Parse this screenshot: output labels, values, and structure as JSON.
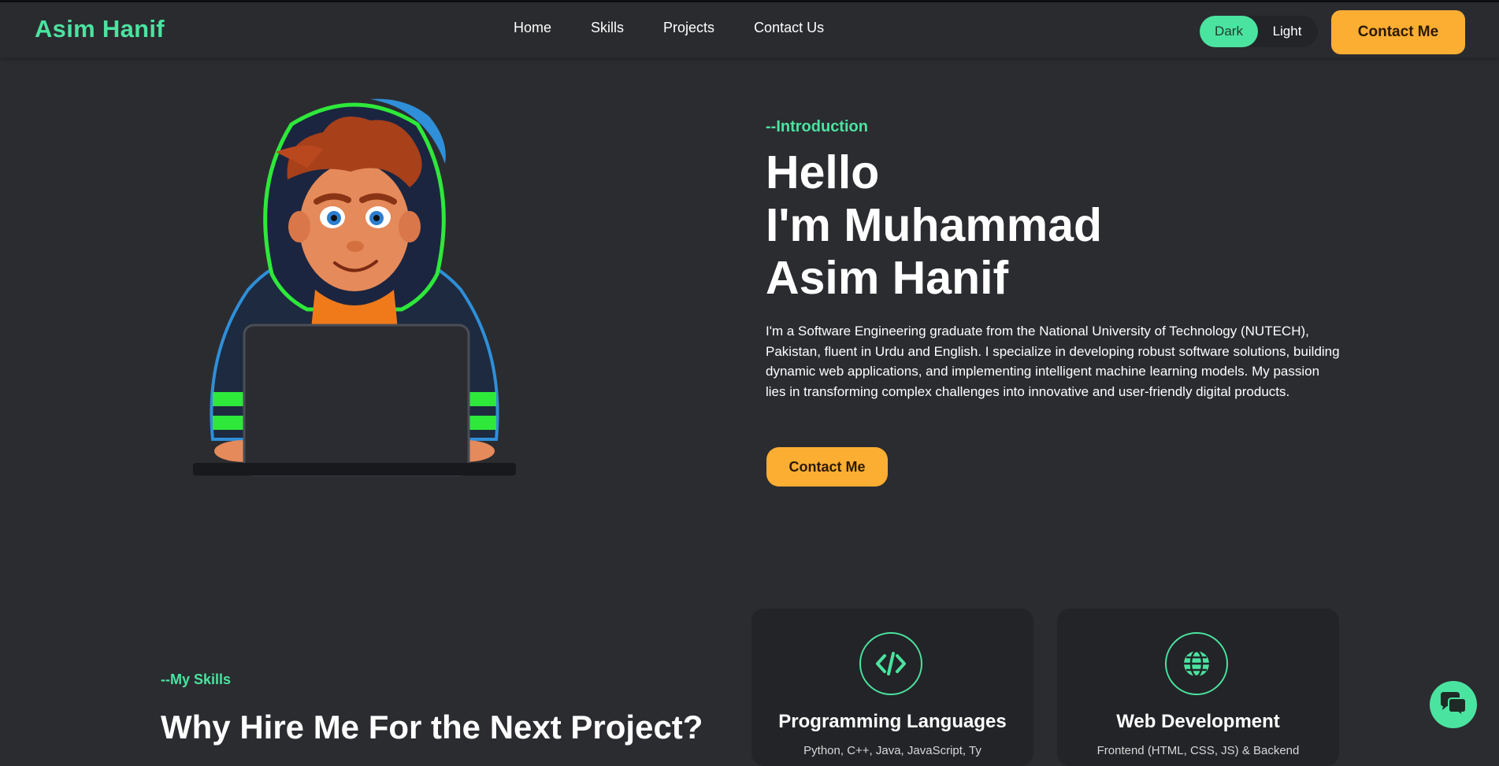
{
  "header": {
    "logo": "Asim Hanif",
    "nav": [
      "Home",
      "Skills",
      "Projects",
      "Contact Us"
    ],
    "theme": {
      "dark_label": "Dark",
      "light_label": "Light",
      "selected": "Dark"
    },
    "cta_label": "Contact Me"
  },
  "hero": {
    "intro_label": "--Introduction",
    "title_lines": [
      "Hello",
      "I'm Muhammad",
      "Asim Hanif"
    ],
    "description": "I'm a Software Engineering graduate from the National University of Technology (NUTECH), Pakistan, fluent in Urdu and English. I specialize in developing robust software solutions, building dynamic web applications, and implementing intelligent machine learning models. My passion lies in transforming complex challenges into innovative and user-friendly digital products.",
    "cta_label": "Contact Me",
    "illustration_icon": "avatar-with-laptop-illustration"
  },
  "skills": {
    "label": "--My Skills",
    "title": "Why Hire Me For the Next Project?",
    "cards": [
      {
        "name": "Programming Languages",
        "description": "Python, C++, Java, JavaScript, Ty",
        "icon": "code-icon"
      },
      {
        "name": "Web Development",
        "description": "Frontend (HTML, CSS, JS) & Backend",
        "icon": "globe-icon"
      }
    ]
  },
  "chat": {
    "icon": "chat-bubbles-icon"
  },
  "colors": {
    "accent": "#4be3a0",
    "cta": "#fcae33",
    "background": "#2b2c30",
    "card": "#232427"
  }
}
